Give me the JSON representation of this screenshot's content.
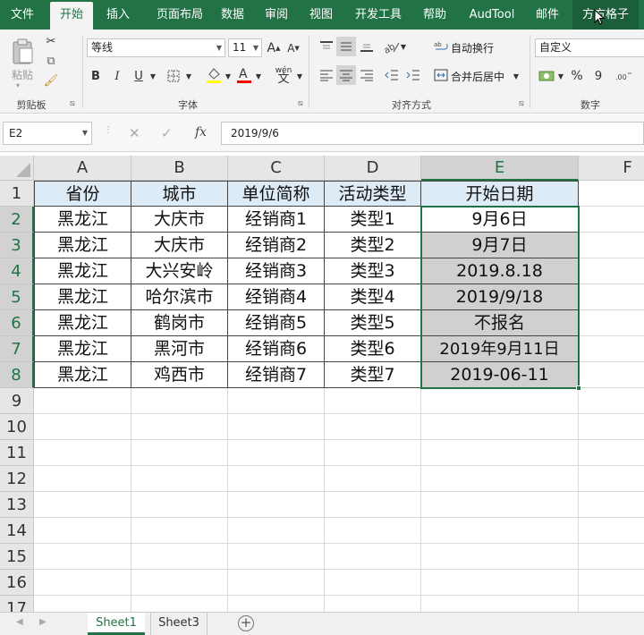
{
  "ribbon_tabs": [
    "文件",
    "开始",
    "插入",
    "页面布局",
    "数据",
    "审阅",
    "视图",
    "开发工具",
    "帮助",
    "AudTool",
    "邮件",
    "方方格子"
  ],
  "active_tab": "开始",
  "clipboard": {
    "paste_label": "粘贴",
    "group_label": "剪贴板"
  },
  "font": {
    "name": "等线",
    "size": "11",
    "grow": "A",
    "shrink": "A",
    "bold": "B",
    "italic": "I",
    "underline": "U",
    "group_label": "字体",
    "phonetic": "wén"
  },
  "alignment": {
    "wrap_label": "自动换行",
    "merge_label": "合并后居中",
    "group_label": "对齐方式"
  },
  "number": {
    "format": "自定义",
    "percent": "%",
    "comma": "9",
    "group_label": "数字"
  },
  "formula_bar": {
    "name_box": "E2",
    "cancel": "✕",
    "enter": "✓",
    "fx": "fx",
    "value": "2019/9/6"
  },
  "columns": [
    "A",
    "B",
    "C",
    "D",
    "E",
    "F"
  ],
  "row_numbers": [
    "1",
    "2",
    "3",
    "4",
    "5",
    "6",
    "7",
    "8",
    "9",
    "10",
    "11",
    "12",
    "13",
    "14",
    "15",
    "16",
    "17"
  ],
  "table": {
    "headers": [
      "省份",
      "城市",
      "单位简称",
      "活动类型",
      "开始日期"
    ],
    "rows": [
      [
        "黑龙江",
        "大庆市",
        "经销商1",
        "类型1",
        "9月6日"
      ],
      [
        "黑龙江",
        "大庆市",
        "经销商2",
        "类型2",
        "9月7日"
      ],
      [
        "黑龙江",
        "大兴安岭",
        "经销商3",
        "类型3",
        "2019.8.18"
      ],
      [
        "黑龙江",
        "哈尔滨市",
        "经销商4",
        "类型4",
        "2019/9/18"
      ],
      [
        "黑龙江",
        "鹤岗市",
        "经销商5",
        "类型5",
        "不报名"
      ],
      [
        "黑龙江",
        "黑河市",
        "经销商6",
        "类型6",
        "2019年9月11日"
      ],
      [
        "黑龙江",
        "鸡西市",
        "经销商7",
        "类型7",
        "2019-06-11"
      ]
    ]
  },
  "sheets": [
    "Sheet1",
    "Sheet3"
  ],
  "active_sheet": "Sheet1",
  "colors": {
    "excel_green": "#217346",
    "header_fill": "#ddebf7",
    "selection_fill": "#d0d0d0"
  }
}
